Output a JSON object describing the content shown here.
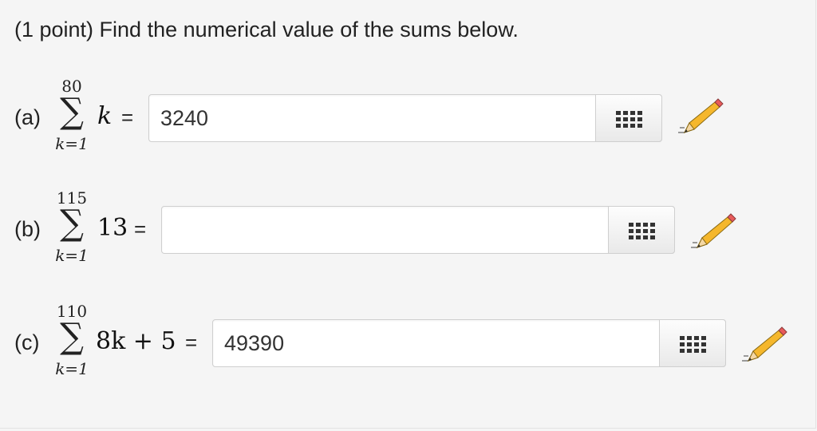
{
  "prompt": "(1 point) Find the numerical value of the sums below.",
  "problems": [
    {
      "label": "(a)",
      "upper": "80",
      "lower": "k=1",
      "expr_main": "k",
      "expr_rest": "",
      "equals": "=",
      "answer": "3240"
    },
    {
      "label": "(b)",
      "upper": "115",
      "lower": "k=1",
      "expr_main": "13",
      "expr_rest": "",
      "equals": "=",
      "answer": ""
    },
    {
      "label": "(c)",
      "upper": "110",
      "lower": "k=1",
      "expr_main": "8k + 5",
      "expr_rest": "",
      "equals": "=",
      "answer": "49390"
    }
  ],
  "icons": {
    "palette": "equation-palette-icon",
    "pencil": "pencil-edit-icon"
  },
  "colors": {
    "pencil_body": "#f5b72c",
    "pencil_tip": "#e85b5b",
    "pencil_shadow": "#9a9a9a"
  }
}
